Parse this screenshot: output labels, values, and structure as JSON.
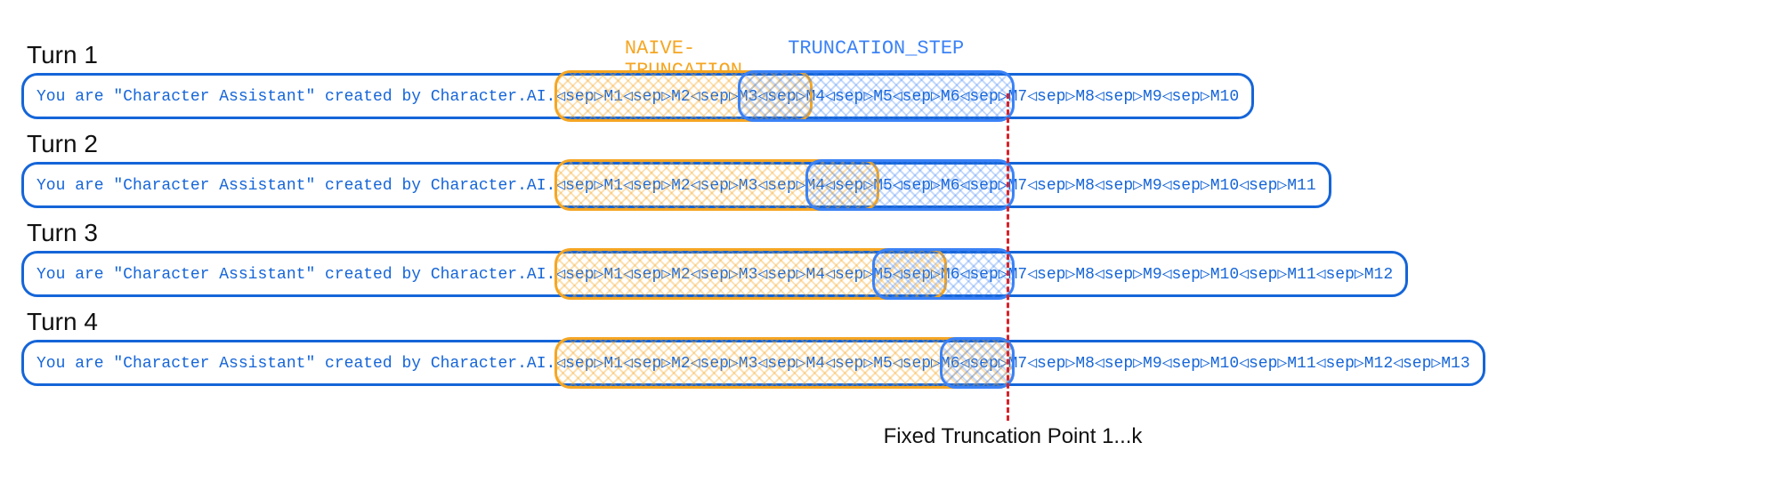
{
  "colors": {
    "pill_border": "#1565d8",
    "pill_text": "#1565d8",
    "naive": "#f5a623",
    "naive_hatch": "rgba(245,166,35,0.35)",
    "step": "#3b82f6",
    "step_hatch": "rgba(59,130,246,0.30)",
    "trunc": "#d8232a"
  },
  "legend": {
    "naive": "NAIVE-TRUNCATION",
    "step": "TRUNCATION_STEP"
  },
  "prefix_text": "You are \"Character Assistant\" created by Character.AI.",
  "sep_token": "◁sep▷",
  "truncation": {
    "after_msg_index": 6,
    "caption": "Fixed Truncation Point 1...k"
  },
  "turns": [
    {
      "label": "Turn 1",
      "msg_count": 10,
      "naive_end_before": 3,
      "step_start_at": 3
    },
    {
      "label": "Turn 2",
      "msg_count": 11,
      "naive_end_before": 4,
      "step_start_at": 4
    },
    {
      "label": "Turn 3",
      "msg_count": 12,
      "naive_end_before": 5,
      "step_start_at": 5
    },
    {
      "label": "Turn 4",
      "msg_count": 13,
      "naive_end_before": 6,
      "step_start_at": 6
    }
  ]
}
